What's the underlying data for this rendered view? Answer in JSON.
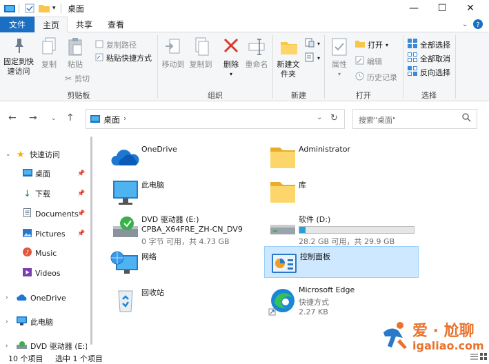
{
  "window": {
    "title": "桌面",
    "controls": {
      "minimize": "—",
      "maximize": "☐",
      "close": "✕"
    }
  },
  "ribbon_tabs": {
    "file": "文件",
    "home": "主页",
    "share": "共享",
    "view": "查看"
  },
  "ribbon": {
    "clipboard": {
      "label": "剪贴板",
      "pin": "固定到快速访问",
      "copy": "复制",
      "paste": "粘贴",
      "copy_path": "复制路径",
      "paste_shortcut": "粘贴快捷方式",
      "cut": "剪切"
    },
    "organize": {
      "label": "组织",
      "move_to": "移动到",
      "copy_to": "复制到",
      "delete": "删除",
      "rename": "重命名"
    },
    "new": {
      "label": "新建",
      "new_folder": "新建文件夹"
    },
    "open": {
      "label": "打开",
      "properties": "属性",
      "open": "打开",
      "edit": "编辑",
      "history": "历史记录"
    },
    "select": {
      "label": "选择",
      "select_all": "全部选择",
      "select_none": "全部取消",
      "invert": "反向选择"
    }
  },
  "address": {
    "path": "桌面",
    "search_placeholder": "搜索\"桌面\""
  },
  "nav": {
    "quick_access": "快速访问",
    "desktop": "桌面",
    "downloads": "下载",
    "documents": "Documents",
    "pictures": "Pictures",
    "music": "Music",
    "videos": "Videos",
    "onedrive": "OneDrive",
    "this_pc": "此电脑",
    "dvd": "DVD 驱动器 (E:)"
  },
  "items": {
    "onedrive": {
      "name": "OneDrive"
    },
    "administrator": {
      "name": "Administrator"
    },
    "this_pc": {
      "name": "此电脑"
    },
    "library": {
      "name": "库"
    },
    "dvd": {
      "name": "DVD 驱动器 (E:)",
      "line2": "CPBA_X64FRE_ZH-CN_DV9",
      "line3": "0 字节 可用，共 4.73 GB"
    },
    "software": {
      "name": "软件 (D:)",
      "info": "28.2 GB 可用，共 29.9 GB",
      "used_fraction": 0.057
    },
    "network": {
      "name": "网络"
    },
    "control_panel": {
      "name": "控制面板"
    },
    "recycle_bin": {
      "name": "回收站"
    },
    "edge": {
      "name": "Microsoft Edge",
      "type": "快捷方式",
      "size": "2.27 KB"
    }
  },
  "status": {
    "count": "10 个项目",
    "selected": "选中 1 个项目"
  },
  "watermark": {
    "cn": "爱 · 尬聊",
    "url": "igaliao.com"
  },
  "colors": {
    "accent": "#1a6fc2",
    "selected_bg": "#cde8ff",
    "drive_fill": "#26a0da",
    "watermark": "#e8732c"
  }
}
